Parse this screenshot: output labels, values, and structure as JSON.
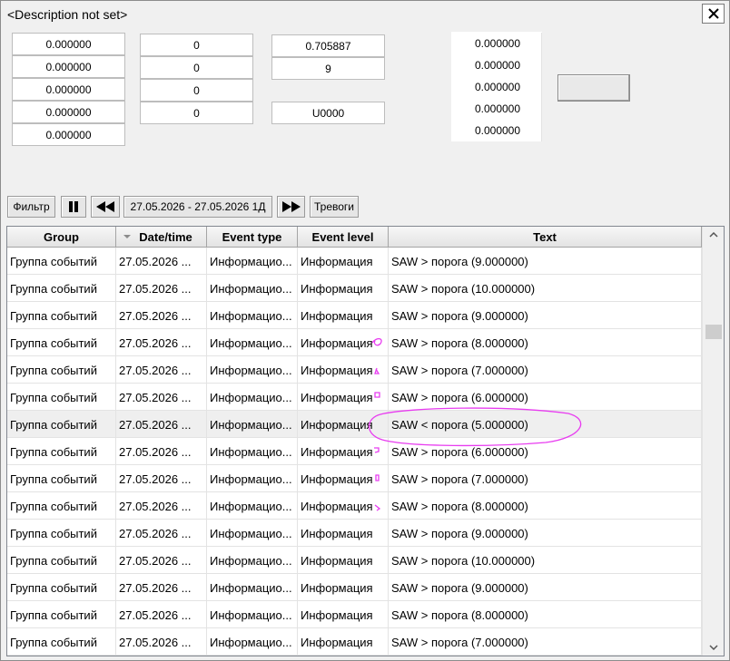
{
  "window": {
    "title": "<Description not set>"
  },
  "fields": {
    "col1": [
      "0.000000",
      "0.000000",
      "0.000000",
      "0.000000",
      "0.000000"
    ],
    "col2": [
      "0",
      "0",
      "0",
      "0"
    ],
    "col3": [
      "0.705887",
      "9",
      "U0000"
    ],
    "col4": [
      "0.000000",
      "0.000000",
      "0.000000",
      "0.000000",
      "0.000000"
    ]
  },
  "toolbar": {
    "filter_label": "Фильтр",
    "date_range": "27.05.2026 - 27.05.2026 1Д",
    "alarms_label": "Тревоги"
  },
  "table": {
    "headers": [
      "Group",
      "Date/time",
      "Event type",
      "Event level",
      "Text"
    ],
    "rows": [
      [
        "Группа событий",
        "27.05.2026 ...",
        "Информацио...",
        "Информация",
        "SAW > порога (9.000000)"
      ],
      [
        "Группа событий",
        "27.05.2026 ...",
        "Информацио...",
        "Информация",
        "SAW > порога (10.000000)"
      ],
      [
        "Группа событий",
        "27.05.2026 ...",
        "Информацио...",
        "Информация",
        "SAW > порога (9.000000)"
      ],
      [
        "Группа событий",
        "27.05.2026 ...",
        "Информацио...",
        "Информация",
        "SAW > порога (8.000000)"
      ],
      [
        "Группа событий",
        "27.05.2026 ...",
        "Информацио...",
        "Информация",
        "SAW > порога (7.000000)"
      ],
      [
        "Группа событий",
        "27.05.2026 ...",
        "Информацио...",
        "Информация",
        "SAW > порога (6.000000)"
      ],
      [
        "Группа событий",
        "27.05.2026 ...",
        "Информацио...",
        "Информация",
        "SAW < порога (5.000000)"
      ],
      [
        "Группа событий",
        "27.05.2026 ...",
        "Информацио...",
        "Информация",
        "SAW > порога (6.000000)"
      ],
      [
        "Группа событий",
        "27.05.2026 ...",
        "Информацио...",
        "Информация",
        "SAW > порога (7.000000)"
      ],
      [
        "Группа событий",
        "27.05.2026 ...",
        "Информацио...",
        "Информация",
        "SAW > порога (8.000000)"
      ],
      [
        "Группа событий",
        "27.05.2026 ...",
        "Информацио...",
        "Информация",
        "SAW > порога (9.000000)"
      ],
      [
        "Группа событий",
        "27.05.2026 ...",
        "Информацио...",
        "Информация",
        "SAW > порога (10.000000)"
      ],
      [
        "Группа событий",
        "27.05.2026 ...",
        "Информацио...",
        "Информация",
        "SAW > порога (9.000000)"
      ],
      [
        "Группа событий",
        "27.05.2026 ...",
        "Информацио...",
        "Информация",
        "SAW > порога (8.000000)"
      ],
      [
        "Группа событий",
        "27.05.2026 ...",
        "Информацио...",
        "Информация",
        "SAW > порога (7.000000)"
      ]
    ],
    "selected_row": 6
  },
  "annotation_color": "#e83cf0"
}
